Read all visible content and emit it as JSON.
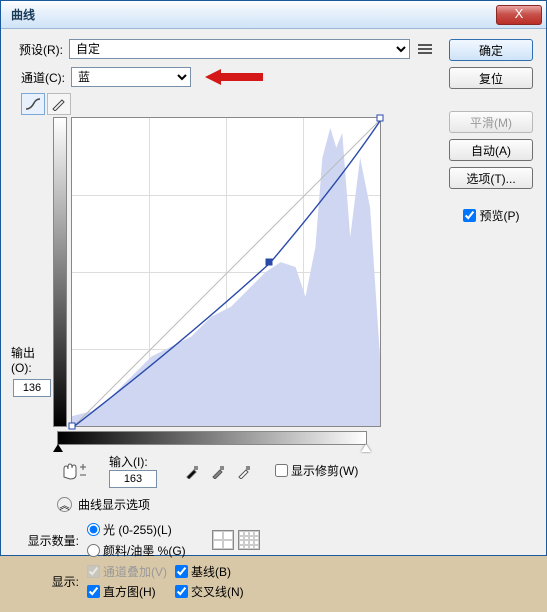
{
  "title": "曲线",
  "preset": {
    "label": "预设(R):",
    "value": "自定"
  },
  "channel": {
    "label": "通道(C):",
    "value": "蓝"
  },
  "buttons": {
    "ok": "确定",
    "reset": "复位",
    "smooth": "平滑(M)",
    "auto": "自动(A)",
    "options": "选项(T)..."
  },
  "preview": {
    "label": "预览(P)",
    "checked": true
  },
  "output": {
    "label": "输出(O):",
    "value": "136"
  },
  "input": {
    "label": "输入(I):",
    "value": "163"
  },
  "showClip": {
    "label": "显示修剪(W)",
    "checked": false
  },
  "optionsToggle": "曲线显示选项",
  "showAmount": {
    "label": "显示数量:",
    "light": "光 (0-255)(L)",
    "pigment": "颜料/油墨 %(G)"
  },
  "show": {
    "label": "显示:",
    "overlay": "通道叠加(V)",
    "baseline": "基线(B)",
    "histogram": "直方图(H)",
    "intersection": "交叉线(N)"
  },
  "chart_data": {
    "type": "line",
    "xlim": [
      0,
      255
    ],
    "ylim": [
      0,
      255
    ],
    "points": [
      {
        "x": 0,
        "y": 0
      },
      {
        "x": 163,
        "y": 136
      },
      {
        "x": 255,
        "y": 255
      }
    ],
    "histogram_shape": "Channel histogram with large peak near highlights (200-255), moderate mass in midtones, low shadows"
  }
}
